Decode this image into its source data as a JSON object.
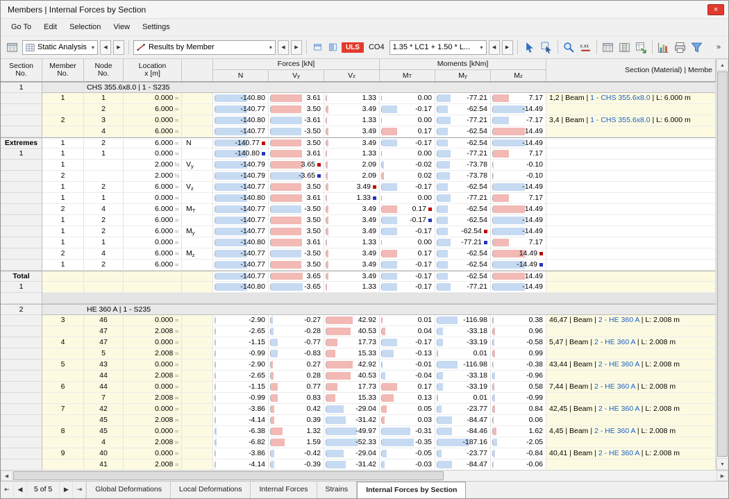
{
  "window": {
    "title": "Members | Internal Forces by Section"
  },
  "icons": {
    "close": "×",
    "chevron_down": "▾",
    "up": "▲",
    "down": "▼",
    "left": "◀",
    "right": "▶",
    "first": "⇤",
    "prev": "◀",
    "next": "▶",
    "last": "⇥"
  },
  "colors": {
    "uls_red": "#E23B2E",
    "link_blue": "#1A5FC8",
    "positive_bar": "#F2B9B5",
    "negative_bar": "#C6DAF2",
    "marker_max": "#C00000",
    "marker_min": "#2233BB"
  },
  "menu": {
    "items": [
      "Go To",
      "Edit",
      "Selection",
      "View",
      "Settings"
    ]
  },
  "toolbar": {
    "static_analysis": {
      "label": "Static Analysis"
    },
    "results_by_member": {
      "label": "Results by Member"
    },
    "uls": "ULS",
    "co": "CO4",
    "combination": "1.35 * LC1 + 1.50 * L...",
    "overflow": "»",
    "buttons": [
      {
        "name": "pick-object-icon",
        "glyph": "cursor"
      },
      {
        "name": "pick-results-icon",
        "glyph": "cursor2"
      },
      {
        "sep": true
      },
      {
        "name": "zoom-icon",
        "glyph": "zoom"
      },
      {
        "name": "decimal-places-icon",
        "glyph": "xxx"
      },
      {
        "sep": true
      },
      {
        "name": "table-display-icon",
        "glyph": "table"
      },
      {
        "name": "table-columns-icon",
        "glyph": "tablecols"
      },
      {
        "name": "table-export-icon",
        "glyph": "tableexport"
      },
      {
        "sep": true
      },
      {
        "name": "result-diagrams-icon",
        "glyph": "chart"
      },
      {
        "name": "print-icon",
        "glyph": "printer"
      },
      {
        "name": "filter-icon",
        "glyph": "funnel"
      }
    ]
  },
  "table": {
    "left_headers": [
      [
        "Section",
        "No."
      ],
      [
        "Member",
        "No."
      ],
      [
        "Node",
        "No."
      ],
      [
        "Location",
        "x [m]"
      ]
    ],
    "group_headers": [
      "Forces [kN]",
      "Moments [kNm]"
    ],
    "value_headers": [
      "N",
      "Vy",
      "Vz",
      "MT",
      "My",
      "Mz"
    ],
    "desc_header": "Section (Material) | Membe",
    "rows": [
      {
        "t": "group",
        "sec": "1",
        "label": "CHS 355.6x8.0 | 1 - S235"
      },
      {
        "t": "data",
        "sec": "",
        "mem": "1",
        "node": "1",
        "loc": "0.000",
        "sym": "≍",
        "v": [
          "-140.80",
          "3.61",
          "1.33",
          "0.00",
          "-77.21",
          "7.17"
        ],
        "desc": [
          "1,2 | Beam | ",
          "1 - CHS 355.6x8.0",
          " | L: 6.000 m"
        ]
      },
      {
        "t": "data",
        "node": "2",
        "loc": "6.000",
        "sym": "≍",
        "v": [
          "-140.77",
          "3.50",
          "3.49",
          "-0.17",
          "-62.54",
          "-14.49"
        ]
      },
      {
        "t": "data",
        "mem": "2",
        "node": "3",
        "loc": "0.000",
        "sym": "≍",
        "v": [
          "-140.80",
          "-3.61",
          "1.33",
          "0.00",
          "-77.21",
          "-7.17"
        ],
        "desc": [
          "3,4 | Beam | ",
          "1 - CHS 355.6x8.0",
          " | L: 6.000 m"
        ]
      },
      {
        "t": "data",
        "node": "4",
        "loc": "6.000",
        "sym": "≍",
        "v": [
          "-140.77",
          "-3.50",
          "3.49",
          "0.17",
          "-62.54",
          "14.49"
        ]
      },
      {
        "t": "ext",
        "bt": true,
        "sec": "Extremes",
        "mem": "1",
        "node": "2",
        "loc": "6.000",
        "sym": "≍",
        "lab": "N",
        "v": [
          "-140.77",
          "3.50",
          "3.49",
          "-0.17",
          "-62.54",
          "-14.49"
        ],
        "mk": 0,
        "mkc": "max"
      },
      {
        "t": "ext",
        "sec": "1",
        "mem": "1",
        "node": "1",
        "loc": "0.000",
        "sym": "≍",
        "v": [
          "-140.80",
          "3.61",
          "1.33",
          "0.00",
          "-77.21",
          "7.17"
        ],
        "mk": 0,
        "mkc": "min"
      },
      {
        "t": "ext",
        "mem": "1",
        "node": "",
        "loc": "2.000",
        "sym": "⅓",
        "lab": "Vy",
        "v": [
          "-140.79",
          "3.65",
          "2.09",
          "-0.02",
          "-73.78",
          "-0.10"
        ],
        "mk": 1,
        "mkc": "max"
      },
      {
        "t": "ext",
        "mem": "2",
        "node": "",
        "loc": "2.000",
        "sym": "⅓",
        "v": [
          "-140.79",
          "-3.65",
          "2.09",
          "0.02",
          "-73.78",
          "-0.10"
        ],
        "mk": 1,
        "mkc": "min"
      },
      {
        "t": "ext",
        "mem": "1",
        "node": "2",
        "loc": "6.000",
        "sym": "≍",
        "lab": "Vz",
        "v": [
          "-140.77",
          "3.50",
          "3.49",
          "-0.17",
          "-62.54",
          "-14.49"
        ],
        "mk": 2,
        "mkc": "max"
      },
      {
        "t": "ext",
        "mem": "1",
        "node": "1",
        "loc": "0.000",
        "sym": "≍",
        "v": [
          "-140.80",
          "3.61",
          "1.33",
          "0.00",
          "-77.21",
          "7.17"
        ],
        "mk": 2,
        "mkc": "min"
      },
      {
        "t": "ext",
        "mem": "2",
        "node": "4",
        "loc": "6.000",
        "sym": "≍",
        "lab": "MT",
        "v": [
          "-140.77",
          "-3.50",
          "3.49",
          "0.17",
          "-62.54",
          "14.49"
        ],
        "mk": 3,
        "mkc": "max"
      },
      {
        "t": "ext",
        "mem": "1",
        "node": "2",
        "loc": "6.000",
        "sym": "≍",
        "v": [
          "-140.77",
          "3.50",
          "3.49",
          "-0.17",
          "-62.54",
          "-14.49"
        ],
        "mk": 3,
        "mkc": "min"
      },
      {
        "t": "ext",
        "mem": "1",
        "node": "2",
        "loc": "6.000",
        "sym": "≍",
        "lab": "My",
        "v": [
          "-140.77",
          "3.50",
          "3.49",
          "-0.17",
          "-62.54",
          "-14.49"
        ],
        "mk": 4,
        "mkc": "max"
      },
      {
        "t": "ext",
        "mem": "1",
        "node": "1",
        "loc": "0.000",
        "sym": "≍",
        "v": [
          "-140.80",
          "3.61",
          "1.33",
          "0.00",
          "-77.21",
          "7.17"
        ],
        "mk": 4,
        "mkc": "min"
      },
      {
        "t": "ext",
        "mem": "2",
        "node": "4",
        "loc": "6.000",
        "sym": "≍",
        "lab": "Mz",
        "v": [
          "-140.77",
          "-3.50",
          "3.49",
          "0.17",
          "-62.54",
          "14.49"
        ],
        "mk": 5,
        "mkc": "max"
      },
      {
        "t": "ext",
        "mem": "1",
        "node": "2",
        "loc": "6.000",
        "sym": "≍",
        "v": [
          "-140.77",
          "3.50",
          "3.49",
          "-0.17",
          "-62.54",
          "-14.49"
        ],
        "mk": 5,
        "mkc": "min"
      },
      {
        "t": "total",
        "bt": true,
        "sec": "Total",
        "v": [
          "-140.77",
          "3.65",
          "3.49",
          "-0.17",
          "-62.54",
          "14.49"
        ]
      },
      {
        "t": "total",
        "sec": "1",
        "v": [
          "-140.80",
          "-3.65",
          "1.33",
          "-0.17",
          "-77.21",
          "-14.49"
        ]
      },
      {
        "t": "gap"
      },
      {
        "t": "group",
        "sec": "2",
        "label": "HE 360 A | 1 - S235"
      },
      {
        "t": "data",
        "mem": "3",
        "node": "46",
        "loc": "0.000",
        "sym": "≍",
        "v": [
          "-2.90",
          "-0.27",
          "42.92",
          "0.01",
          "-116.98",
          "0.38"
        ],
        "desc": [
          "46,47 | Beam | ",
          "2 - HE 360 A",
          " | L: 2.008 m"
        ]
      },
      {
        "t": "data",
        "node": "47",
        "loc": "2.008",
        "sym": "≍",
        "v": [
          "-2.65",
          "-0.28",
          "40.53",
          "0.04",
          "-33.18",
          "0.96"
        ]
      },
      {
        "t": "data",
        "mem": "4",
        "node": "47",
        "loc": "0.000",
        "sym": "≍",
        "v": [
          "-1.15",
          "-0.77",
          "17.73",
          "-0.17",
          "-33.19",
          "-0.58"
        ],
        "desc": [
          "5,47 | Beam | ",
          "2 - HE 360 A",
          " | L: 2.008 m"
        ]
      },
      {
        "t": "data",
        "node": "5",
        "loc": "2.008",
        "sym": "≍",
        "v": [
          "-0.99",
          "-0.83",
          "15.33",
          "-0.13",
          "0.01",
          "0.99"
        ]
      },
      {
        "t": "data",
        "mem": "5",
        "node": "43",
        "loc": "0.000",
        "sym": "≍",
        "v": [
          "-2.90",
          "0.27",
          "42.92",
          "-0.01",
          "-116.98",
          "-0.38"
        ],
        "desc": [
          "43,44 | Beam | ",
          "2 - HE 360 A",
          " | L: 2.008 m"
        ]
      },
      {
        "t": "data",
        "node": "44",
        "loc": "2.008",
        "sym": "≍",
        "v": [
          "-2.65",
          "0.28",
          "40.53",
          "-0.04",
          "-33.18",
          "-0.96"
        ]
      },
      {
        "t": "data",
        "mem": "6",
        "node": "44",
        "loc": "0.000",
        "sym": "≍",
        "v": [
          "-1.15",
          "0.77",
          "17.73",
          "0.17",
          "-33.19",
          "0.58"
        ],
        "desc": [
          "7,44 | Beam | ",
          "2 - HE 360 A",
          " | L: 2.008 m"
        ]
      },
      {
        "t": "data",
        "node": "7",
        "loc": "2.008",
        "sym": "≍",
        "v": [
          "-0.99",
          "0.83",
          "15.33",
          "0.13",
          "0.01",
          "-0.99"
        ]
      },
      {
        "t": "data",
        "mem": "7",
        "node": "42",
        "loc": "0.000",
        "sym": "≍",
        "v": [
          "-3.86",
          "0.42",
          "-29.04",
          "0.05",
          "-23.77",
          "0.84"
        ],
        "desc": [
          "42,45 | Beam | ",
          "2 - HE 360 A",
          " | L: 2.008 m"
        ]
      },
      {
        "t": "data",
        "node": "45",
        "loc": "2.008",
        "sym": "≍",
        "v": [
          "-4.14",
          "0.39",
          "-31.42",
          "0.03",
          "-84.47",
          "0.06"
        ]
      },
      {
        "t": "data",
        "mem": "8",
        "node": "45",
        "loc": "0.000",
        "sym": "≍",
        "v": [
          "-6.38",
          "1.32",
          "-49.97",
          "-0.31",
          "-84.46",
          "1.62"
        ],
        "desc": [
          "4,45 | Beam | ",
          "2 - HE 360 A",
          " | L: 2.008 m"
        ]
      },
      {
        "t": "data",
        "node": "4",
        "loc": "2.008",
        "sym": "≍",
        "v": [
          "-6.82",
          "1.59",
          "-52.33",
          "-0.35",
          "-187.16",
          "-2.05"
        ]
      },
      {
        "t": "data",
        "mem": "9",
        "node": "40",
        "loc": "0.000",
        "sym": "≍",
        "v": [
          "-3.86",
          "-0.42",
          "-29.04",
          "-0.05",
          "-23.77",
          "-0.84"
        ],
        "desc": [
          "40,41 | Beam | ",
          "2 - HE 360 A",
          " | L: 2.008 m"
        ]
      },
      {
        "t": "data",
        "node": "41",
        "loc": "2.008",
        "sym": "≍",
        "v": [
          "-4.14",
          "-0.39",
          "-31.42",
          "-0.03",
          "-84.47",
          "-0.06"
        ]
      }
    ]
  },
  "tabbar": {
    "pager": "5 of 5",
    "tabs": [
      {
        "label": "Global Deformations",
        "active": false
      },
      {
        "label": "Local Deformations",
        "active": false
      },
      {
        "label": "Internal Forces",
        "active": false
      },
      {
        "label": "Strains",
        "active": false
      },
      {
        "label": "Internal Forces by Section",
        "active": true
      }
    ]
  }
}
